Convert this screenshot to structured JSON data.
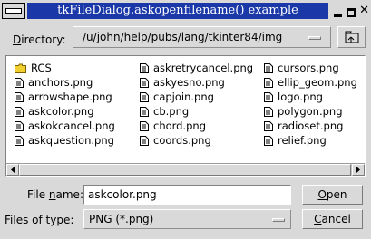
{
  "window": {
    "title": "tkFileDialog.askopenfilename() example"
  },
  "directory": {
    "label": "Directory:",
    "value": "/u/john/help/pubs/lang/tkinter84/img"
  },
  "files": {
    "col1": [
      {
        "name": "RCS",
        "icon": "folder-icon"
      },
      {
        "name": "anchors.png",
        "icon": "file-icon"
      },
      {
        "name": "arrowshape.png",
        "icon": "file-icon"
      },
      {
        "name": "askcolor.png",
        "icon": "file-icon"
      },
      {
        "name": "askokcancel.png",
        "icon": "file-icon"
      },
      {
        "name": "askquestion.png",
        "icon": "file-icon"
      }
    ],
    "col2": [
      {
        "name": "askretrycancel.png",
        "icon": "file-icon"
      },
      {
        "name": "askyesno.png",
        "icon": "file-icon"
      },
      {
        "name": "capjoin.png",
        "icon": "file-icon"
      },
      {
        "name": "cb.png",
        "icon": "file-icon"
      },
      {
        "name": "chord.png",
        "icon": "file-icon"
      },
      {
        "name": "coords.png",
        "icon": "file-icon"
      }
    ],
    "col3": [
      {
        "name": "cursors.png",
        "icon": "file-icon"
      },
      {
        "name": "ellip_geom.png",
        "icon": "file-icon"
      },
      {
        "name": "logo.png",
        "icon": "file-icon"
      },
      {
        "name": "polygon.png",
        "icon": "file-icon"
      },
      {
        "name": "radioset.png",
        "icon": "file-icon"
      },
      {
        "name": "relief.png",
        "icon": "file-icon"
      }
    ]
  },
  "filename": {
    "label_pre": "File ",
    "label_ul": "n",
    "label_post": "ame:",
    "value": "askcolor.png"
  },
  "filetype": {
    "label_pre": "Files of ",
    "label_ul": "t",
    "label_post": "ype:",
    "value": "PNG (*.png)"
  },
  "buttons": {
    "open_ul": "O",
    "open_rest": "pen",
    "cancel_ul": "C",
    "cancel_rest": "ancel"
  },
  "directory_label_parts": {
    "ul": "D",
    "rest": "irectory:"
  }
}
